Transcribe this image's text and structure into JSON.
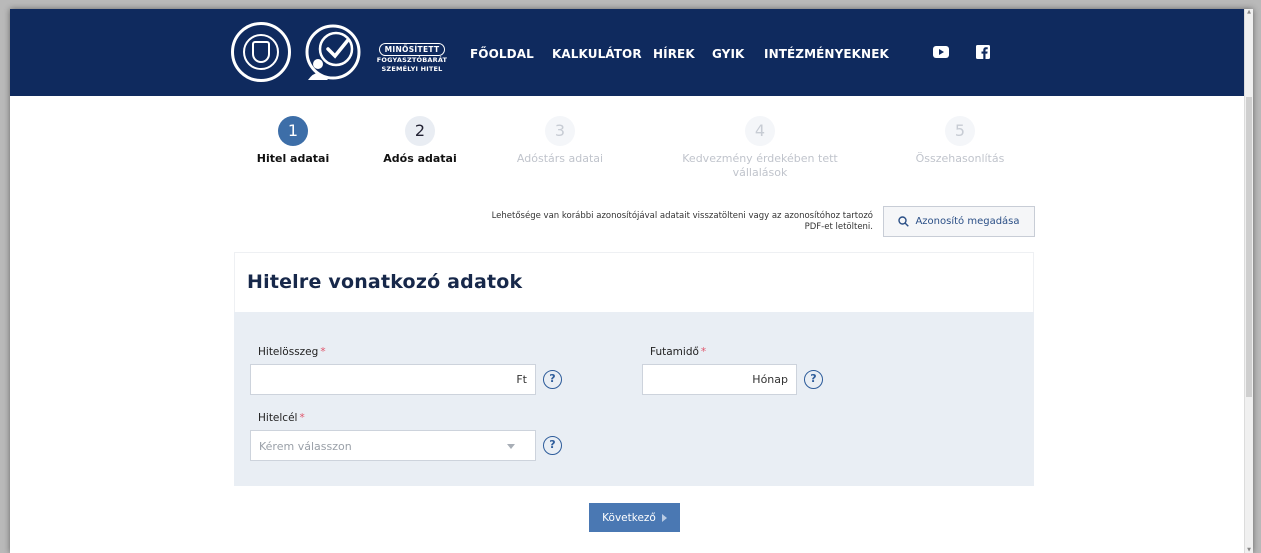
{
  "header": {
    "brand": {
      "badge": "MINŐSÍTETT",
      "line1": "FOGYASZTÓBARÁT",
      "line2": "SZEMÉLYI HITEL"
    },
    "nav": [
      "FŐOLDAL",
      "KALKULÁTOR",
      "HÍREK",
      "GYIK",
      "INTÉZMÉNYEKNEK"
    ],
    "social": [
      "youtube-icon",
      "facebook-icon"
    ]
  },
  "steps": [
    {
      "number": "1",
      "label": "Hitel adatai",
      "state": "active"
    },
    {
      "number": "2",
      "label": "Adós adatai",
      "state": "done"
    },
    {
      "number": "3",
      "label": "Adóstárs adatai",
      "state": "todo"
    },
    {
      "number": "4",
      "label": "Kedvezmény érdekében tett vállalások",
      "state": "todo"
    },
    {
      "number": "5",
      "label": "Összehasonlítás",
      "state": "todo"
    }
  ],
  "load": {
    "info": "Lehetősége van korábbi azonosítójával adatait visszatölteni vagy az azonosítóhoz tartozó PDF-et letölteni.",
    "button": "Azonosító megadása"
  },
  "form": {
    "title": "Hitelre vonatkozó adatok",
    "amount": {
      "label": "Hitelösszeg",
      "required": "*",
      "value": "",
      "unit": "Ft"
    },
    "term": {
      "label": "Futamidő",
      "required": "*",
      "value": "",
      "unit": "Hónap"
    },
    "purpose": {
      "label": "Hitelcél",
      "required": "*",
      "placeholder": "Kérem válasszon"
    },
    "help_symbol": "?"
  },
  "next_button": "Következő",
  "colors": {
    "header_bg": "#0f2a5e",
    "accent": "#4a78b3",
    "form_bg": "#e9eef4",
    "required": "#e0556b"
  }
}
